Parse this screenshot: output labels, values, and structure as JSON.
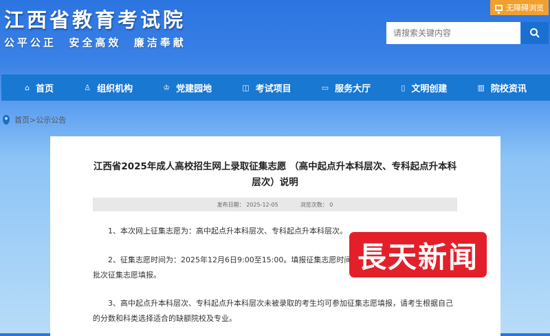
{
  "header": {
    "title": "江西省教育考试院",
    "slogan": "公平公正  安全高效  廉洁奉献",
    "accessibility": "无障碍浏览",
    "search_placeholder": "请搜索关键内容"
  },
  "nav": [
    {
      "label": "首页",
      "icon": "⌂"
    },
    {
      "label": "组织机构",
      "icon": "♙"
    },
    {
      "label": "党建园地",
      "icon": "♔"
    },
    {
      "label": "考试项目",
      "icon": "◫"
    },
    {
      "label": "服务大厅",
      "icon": "▭"
    },
    {
      "label": "文明创建",
      "icon": "▯"
    },
    {
      "label": "院校资讯",
      "icon": "▥"
    }
  ],
  "breadcrumb": "首页>公示公告",
  "article": {
    "title": "江西省2025年成人高校招生网上录取征集志愿 （高中起点升本科层次、专科起点升本科层次）说明",
    "date": "发布日期： 2025-12-05",
    "views": "浏览次数： 0",
    "paragraphs": [
      "1、本次网上征集志愿为：高中起点升本科层次、专科起点升本科层次。",
      "2、征集志愿时间为：2025年12月6日9:00至15:00。填报征集志愿时间截止……考生视为自愿放弃本批次征集志愿填报。",
      "3、高中起点升本科层次、专科起点升本科层次未被录取的考生均可参加征集志愿填报，请考生根据自己的分数和科类选择适合的缺额院校及专业。"
    ]
  },
  "watermark": "長天新闻"
}
